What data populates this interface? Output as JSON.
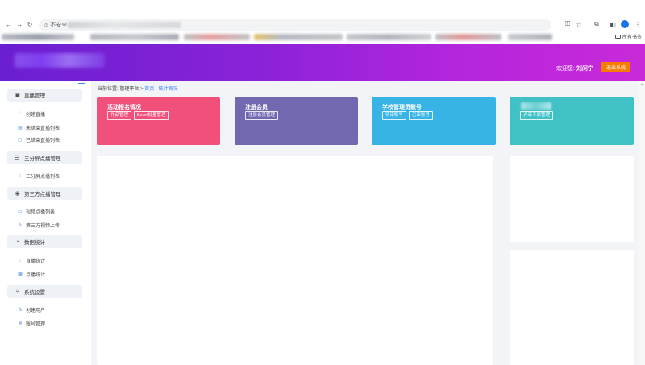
{
  "browser": {
    "omnibox_warning": "⚠ 不安全"
  },
  "bookmarks": {
    "folder_label": "所有书签"
  },
  "header": {
    "welcome_label": "欢迎您:",
    "username": "刘问宁",
    "logout_label": "退出系统"
  },
  "sidebar": {
    "groups": [
      {
        "label": "直播管理",
        "icon": "broadcast-icon"
      },
      {
        "label": "三分屏点播管理",
        "icon": "list-icon"
      },
      {
        "label": "第三方点播管理",
        "icon": "play-circle-icon"
      },
      {
        "label": "数据统计",
        "icon": "chart-icon"
      },
      {
        "label": "系统设置",
        "icon": "settings-icon"
      }
    ],
    "items": [
      {
        "label": "创建直播",
        "icon": "create-live-icon"
      },
      {
        "label": "未结束直播列表",
        "icon": "list-icon"
      },
      {
        "label": "已结束直播列表",
        "icon": "archive-icon"
      },
      {
        "label": "三分屏点播列表",
        "icon": "list-icon"
      },
      {
        "label": "视频点播列表",
        "icon": "video-icon"
      },
      {
        "label": "第三方视频上传",
        "icon": "upload-icon"
      },
      {
        "label": "直播统计",
        "icon": "stats-icon"
      },
      {
        "label": "点播统计",
        "icon": "stats-icon"
      },
      {
        "label": "创建用户",
        "icon": "user-add-icon"
      },
      {
        "label": "账号管理",
        "icon": "gear-icon"
      }
    ]
  },
  "breadcrumb": {
    "prefix": "当前位置: 管理平台 > ",
    "link": "首页 - 统计概况"
  },
  "cards": [
    {
      "title": "活动报名情况",
      "tags": [
        "作品管理",
        "Excel批量管理"
      ],
      "color": "#f0507a"
    },
    {
      "title": "注册会员",
      "tags": [
        "注册会员管理"
      ],
      "color": "#7069b1"
    },
    {
      "title": "学校管理员账号",
      "tags": [
        "待审账号",
        "已审账号"
      ],
      "color": "#37b3e5"
    },
    {
      "title": "",
      "tags": [
        "评审专家管理"
      ],
      "color": "#3fc1c5"
    }
  ]
}
